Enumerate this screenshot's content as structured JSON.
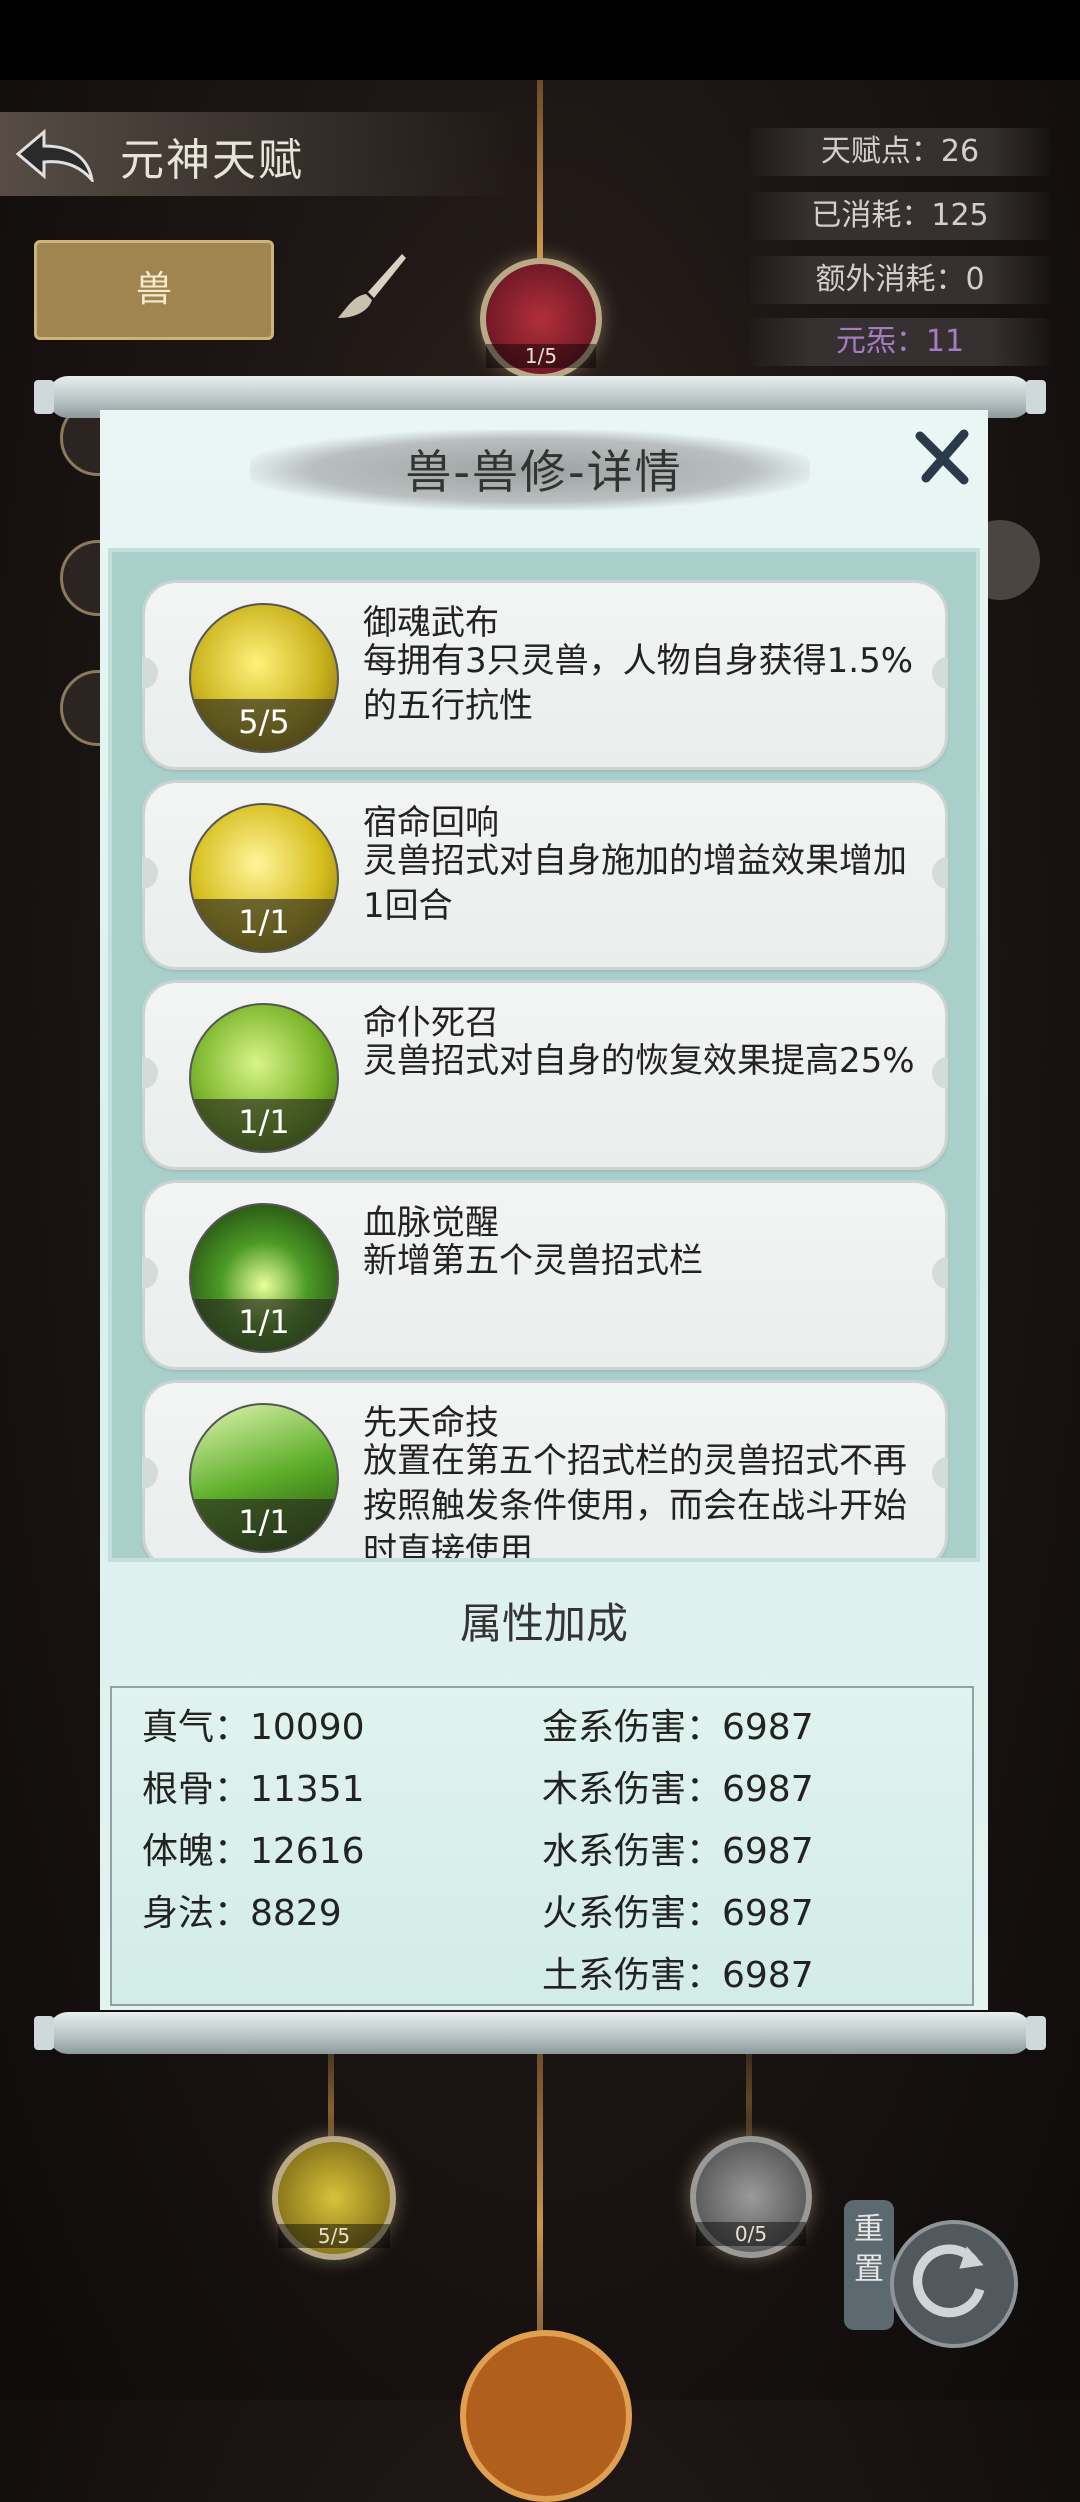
{
  "header": {
    "title": "元神天赋",
    "stats": {
      "talent_points": "天赋点：26",
      "consumed": "已消耗：125",
      "extra_consumed": "额外消耗：0",
      "element": "元炁：11"
    }
  },
  "tabs": {
    "beast_tab": "兽"
  },
  "tree": {
    "top_node_count": "1/5",
    "bottom_left_node_count": "5/5",
    "bottom_right_node_count": "0/5",
    "reset_label": "重置"
  },
  "dialog": {
    "title": "兽-兽修-详情",
    "skills": [
      {
        "name": "御魂武布",
        "level": "5/5",
        "desc": "每拥有3只灵兽，人物自身获得1.5%的五行抗性",
        "color": "#c9b21c"
      },
      {
        "name": "宿命回响",
        "level": "1/1",
        "desc": "灵兽招式对自身施加的增益效果增加1回合",
        "color": "#d6be1e"
      },
      {
        "name": "命仆死召",
        "level": "1/1",
        "desc": "灵兽招式对自身的恢复效果提高25%",
        "color": "#79b428"
      },
      {
        "name": "血脉觉醒",
        "level": "1/1",
        "desc": "新增第五个灵兽招式栏",
        "color": "#2f6a1c"
      },
      {
        "name": "先天命技",
        "level": "1/1",
        "desc": "放置在第五个招式栏的灵兽招式不再按照触发条件使用，而会在战斗开始时直接使用",
        "color": "#5eae2a"
      }
    ],
    "attributes_title": "属性加成",
    "attributes_left": [
      "真气：10090",
      "根骨：11351",
      "体魄：12616",
      "身法：8829"
    ],
    "attributes_right": [
      "金系伤害：6987",
      "木系伤害：6987",
      "水系伤害：6987",
      "火系伤害：6987",
      "土系伤害：6987"
    ]
  }
}
